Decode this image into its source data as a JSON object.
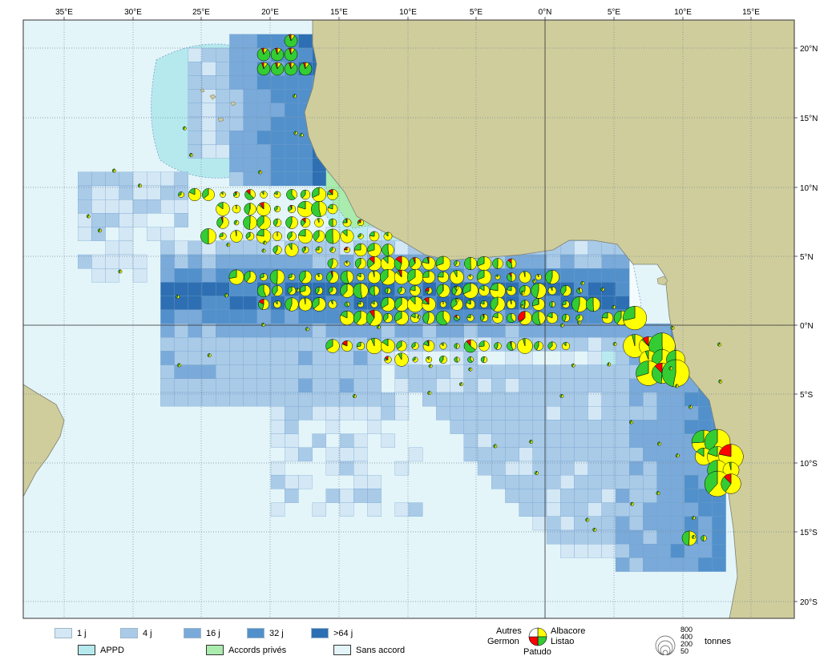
{
  "map": {
    "lon_ticks": [
      "35°E",
      "30°E",
      "25°E",
      "20°E",
      "15°E",
      "10°E",
      "5°E",
      "0°N",
      "5°E",
      "10°E",
      "15°E"
    ],
    "lat_ticks": [
      "20°N",
      "15°N",
      "10°N",
      "5°N",
      "0°N",
      "5°S",
      "10°S",
      "15°S",
      "20°S"
    ],
    "colors": {
      "ocean": "#e3f5f9",
      "land": "#cfcd9c",
      "land_border": "#7f8070",
      "appd": "#b5e9ee",
      "accords": "#a9ecad",
      "effort_1": "#d3e7f5",
      "effort_4": "#a9cbe8",
      "effort_16": "#7aaad9",
      "effort_32": "#5190cb",
      "effort_64": "#2d6fb2",
      "yellow": "#ffff00",
      "green": "#33cc33",
      "red": "#ff0000"
    }
  },
  "legend": {
    "effort": [
      {
        "label": "1 j",
        "color": "#d3e7f5"
      },
      {
        "label": "4 j",
        "color": "#a9cbe8"
      },
      {
        "label": "16 j",
        "color": "#7aaad9"
      },
      {
        "label": "32 j",
        "color": "#5190cb"
      },
      {
        "label": ">64 j",
        "color": "#2d6fb2"
      }
    ],
    "zones": [
      {
        "label": "APPD",
        "color": "#b5e9ee"
      },
      {
        "label": "Accords privés",
        "color": "#a9ecad"
      },
      {
        "label": "Sans accord",
        "color": "#e3f5f9"
      }
    ],
    "species": {
      "autres": "Autres",
      "germon": "Germon",
      "patudo": "Patudo",
      "albacore": "Albacore",
      "listao": "Listao"
    },
    "sizes": {
      "values": [
        "800",
        "400",
        "200",
        "50"
      ],
      "unit": "tonnes"
    }
  }
}
